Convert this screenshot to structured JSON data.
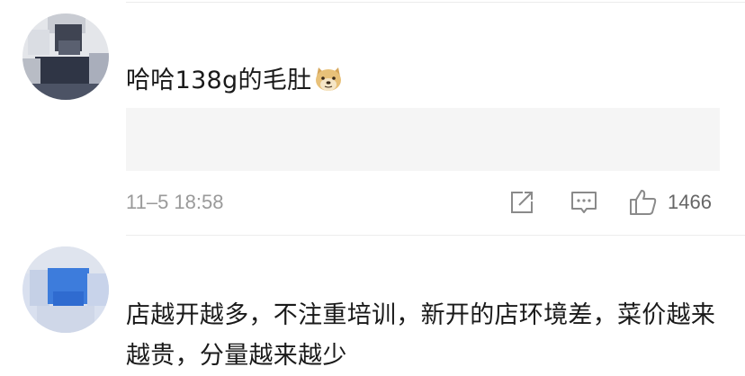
{
  "comments": [
    {
      "text": "哈哈138g的毛肚",
      "emoji": "doge-emoji",
      "time": "11–5 18:58",
      "likes": "1466"
    },
    {
      "text": "店越开越多，不注重培训，新开的店环境差，菜价越来越贵，分量越来越少"
    }
  ],
  "colors": {
    "text": "#1a1a1a",
    "meta": "#9a9a9a",
    "icon": "#8a8a8a",
    "quote_bg": "#f5f5f5",
    "divider": "#ececec"
  }
}
